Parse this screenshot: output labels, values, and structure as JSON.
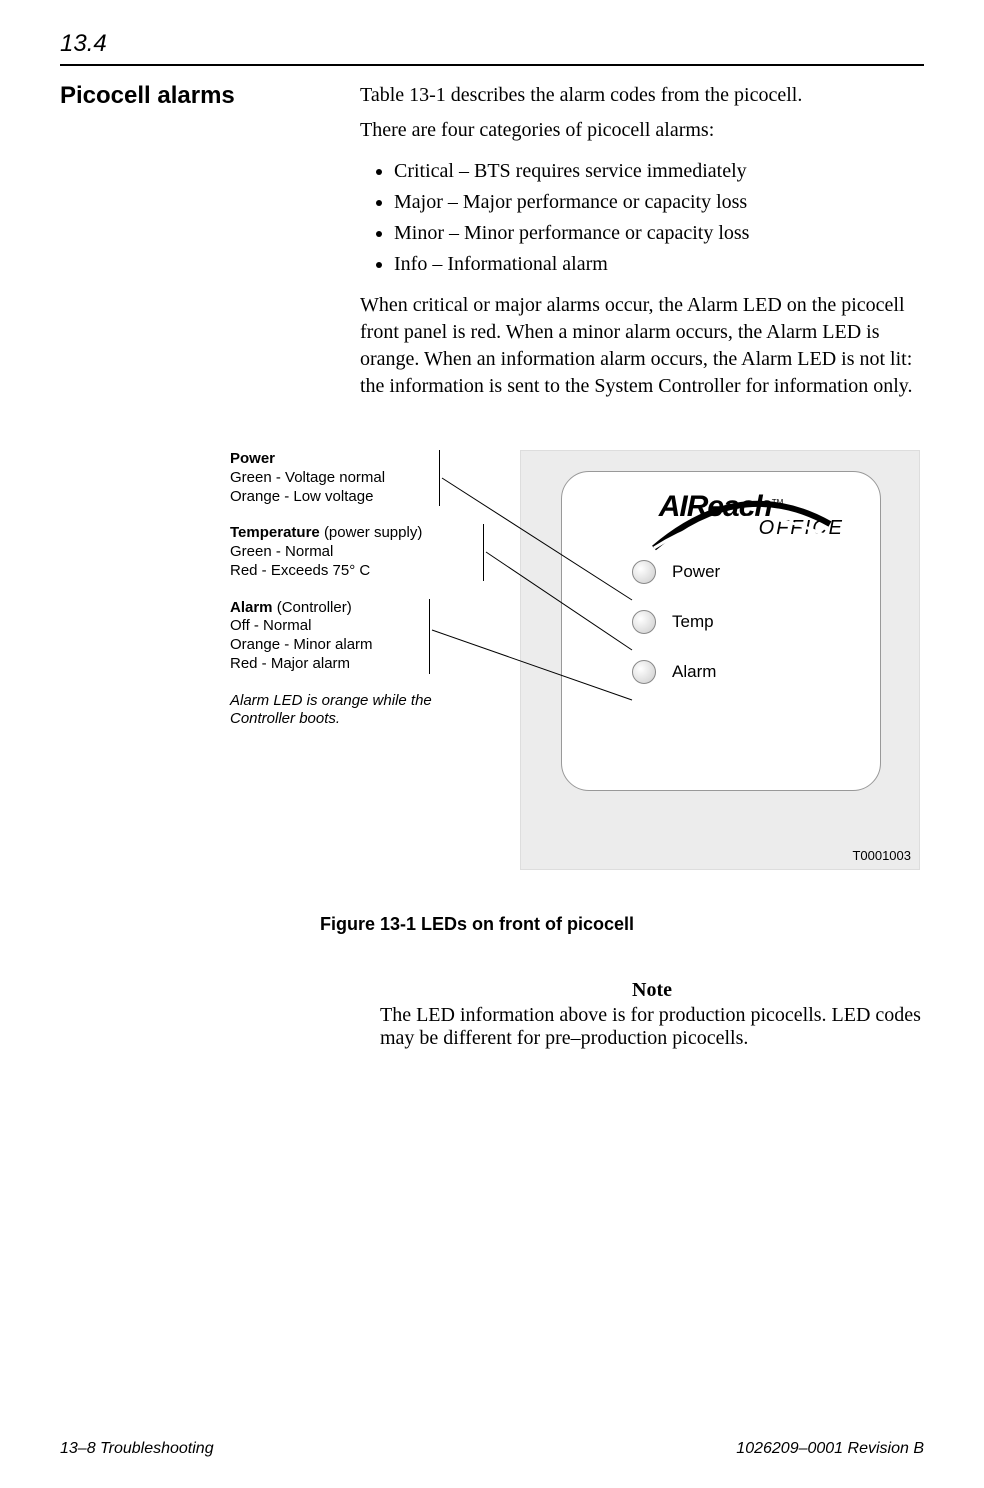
{
  "header": {
    "section_number": "13.4"
  },
  "sidebar": {
    "title": "Picocell alarms"
  },
  "body": {
    "intro1": "Table 13-1  describes the alarm codes from the picocell.",
    "intro2": "There are four categories of picocell alarms:",
    "categories": [
      "Critical – BTS requires service immediately",
      "Major – Major performance or capacity loss",
      "Minor – Minor performance or capacity loss",
      "Info – Informational alarm"
    ],
    "when": "When critical or major alarms occur, the Alarm LED on the picocell front panel is red. When a minor alarm occurs, the Alarm LED is orange. When an information alarm occurs, the Alarm LED is not lit: the information is sent to the System Controller for information only."
  },
  "figure": {
    "callouts": {
      "power": {
        "title": "Power",
        "lines": [
          "Green - Voltage normal",
          "Orange - Low voltage"
        ]
      },
      "temp": {
        "title": "Temperature",
        "paren": "(power supply)",
        "lines": [
          "Green - Normal",
          "Red - Exceeds 75° C"
        ]
      },
      "alarm": {
        "title": "Alarm",
        "paren": "(Controller)",
        "lines": [
          "Off - Normal",
          "Orange - Minor alarm",
          "Red - Major alarm"
        ]
      },
      "bootnote": "Alarm LED is orange while the Controller boots."
    },
    "device": {
      "brand_top": "AIReach",
      "brand_tm": "TM",
      "brand_sub": "OFFICE",
      "leds": [
        "Power",
        "Temp",
        "Alarm"
      ]
    },
    "figno": "T0001003",
    "caption": "Figure  13-1    LEDs on front of picocell"
  },
  "note": {
    "label": "Note",
    "text": "The LED information above is for production picocells. LED codes may be different for pre–production picocells."
  },
  "footer": {
    "left": "13–8  Troubleshooting",
    "right": "1026209–0001  Revision B"
  }
}
